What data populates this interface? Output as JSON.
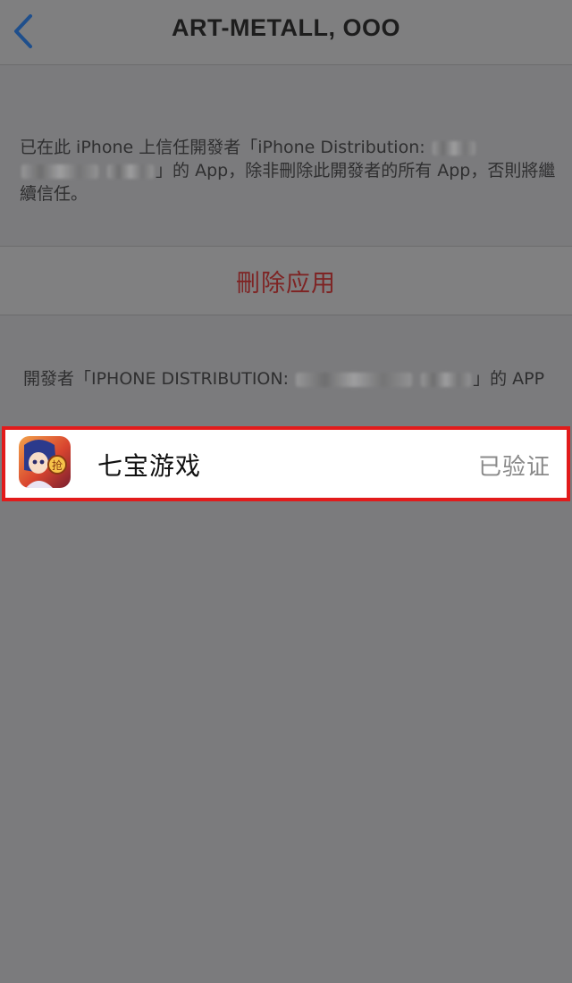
{
  "nav": {
    "title": "ART-METALL, OOO",
    "back_icon": "chevron-left-icon",
    "accent_color": "#1f4f8c"
  },
  "trust_message": {
    "part1": "已在此 iPhone 上信任開發者「iPhone Distribution:",
    "part2": "」的 App，除非刪除此開發者的所有 App，否則將繼續信任。"
  },
  "delete_action": {
    "label": "刪除应用",
    "color": "#7e2424"
  },
  "section_header": {
    "prefix": "開發者「IPHONE DISTRIBUTION:",
    "suffix": "」的 APP"
  },
  "app_list": [
    {
      "name": "七宝游戏",
      "status": "已验证",
      "icon": "app-icon-game"
    }
  ],
  "colors": {
    "highlight_border": "#e21b1b",
    "dim_background": "#7b7b7d"
  }
}
